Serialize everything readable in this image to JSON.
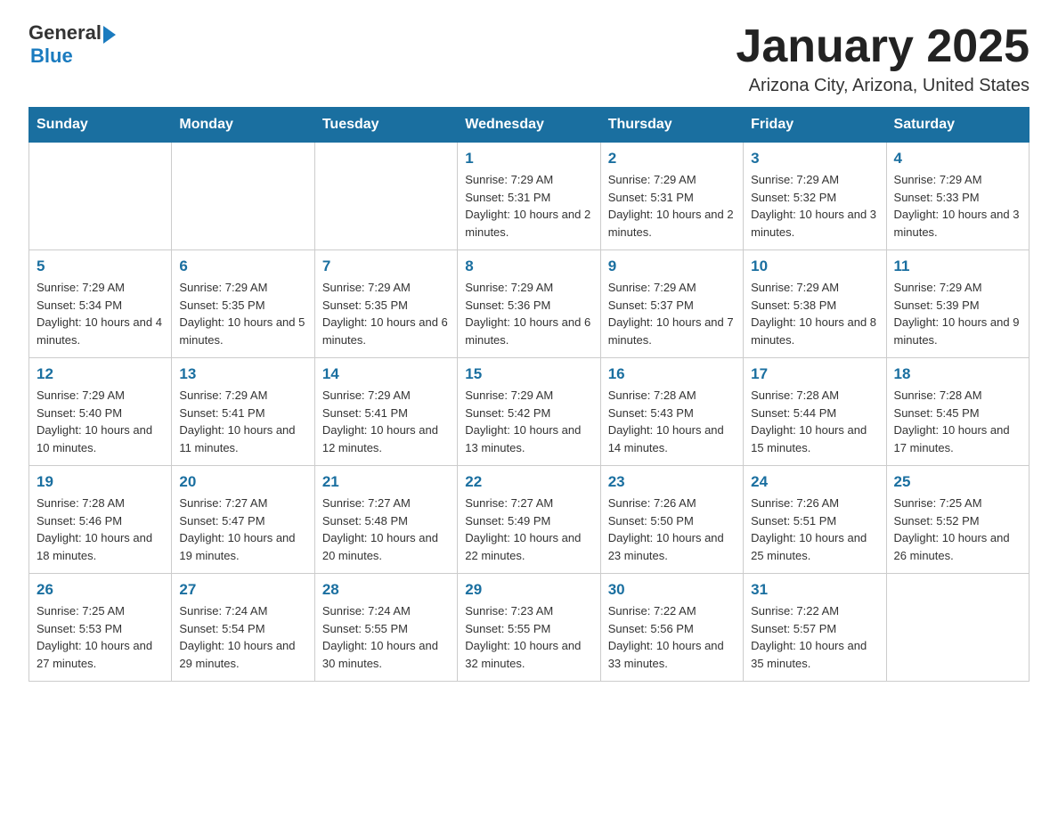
{
  "logo": {
    "general": "General",
    "blue": "Blue",
    "line2": "Blue"
  },
  "header": {
    "title": "January 2025",
    "subtitle": "Arizona City, Arizona, United States"
  },
  "days_of_week": [
    "Sunday",
    "Monday",
    "Tuesday",
    "Wednesday",
    "Thursday",
    "Friday",
    "Saturday"
  ],
  "weeks": [
    [
      {
        "day": "",
        "info": ""
      },
      {
        "day": "",
        "info": ""
      },
      {
        "day": "",
        "info": ""
      },
      {
        "day": "1",
        "info": "Sunrise: 7:29 AM\nSunset: 5:31 PM\nDaylight: 10 hours and 2 minutes."
      },
      {
        "day": "2",
        "info": "Sunrise: 7:29 AM\nSunset: 5:31 PM\nDaylight: 10 hours and 2 minutes."
      },
      {
        "day": "3",
        "info": "Sunrise: 7:29 AM\nSunset: 5:32 PM\nDaylight: 10 hours and 3 minutes."
      },
      {
        "day": "4",
        "info": "Sunrise: 7:29 AM\nSunset: 5:33 PM\nDaylight: 10 hours and 3 minutes."
      }
    ],
    [
      {
        "day": "5",
        "info": "Sunrise: 7:29 AM\nSunset: 5:34 PM\nDaylight: 10 hours and 4 minutes."
      },
      {
        "day": "6",
        "info": "Sunrise: 7:29 AM\nSunset: 5:35 PM\nDaylight: 10 hours and 5 minutes."
      },
      {
        "day": "7",
        "info": "Sunrise: 7:29 AM\nSunset: 5:35 PM\nDaylight: 10 hours and 6 minutes."
      },
      {
        "day": "8",
        "info": "Sunrise: 7:29 AM\nSunset: 5:36 PM\nDaylight: 10 hours and 6 minutes."
      },
      {
        "day": "9",
        "info": "Sunrise: 7:29 AM\nSunset: 5:37 PM\nDaylight: 10 hours and 7 minutes."
      },
      {
        "day": "10",
        "info": "Sunrise: 7:29 AM\nSunset: 5:38 PM\nDaylight: 10 hours and 8 minutes."
      },
      {
        "day": "11",
        "info": "Sunrise: 7:29 AM\nSunset: 5:39 PM\nDaylight: 10 hours and 9 minutes."
      }
    ],
    [
      {
        "day": "12",
        "info": "Sunrise: 7:29 AM\nSunset: 5:40 PM\nDaylight: 10 hours and 10 minutes."
      },
      {
        "day": "13",
        "info": "Sunrise: 7:29 AM\nSunset: 5:41 PM\nDaylight: 10 hours and 11 minutes."
      },
      {
        "day": "14",
        "info": "Sunrise: 7:29 AM\nSunset: 5:41 PM\nDaylight: 10 hours and 12 minutes."
      },
      {
        "day": "15",
        "info": "Sunrise: 7:29 AM\nSunset: 5:42 PM\nDaylight: 10 hours and 13 minutes."
      },
      {
        "day": "16",
        "info": "Sunrise: 7:28 AM\nSunset: 5:43 PM\nDaylight: 10 hours and 14 minutes."
      },
      {
        "day": "17",
        "info": "Sunrise: 7:28 AM\nSunset: 5:44 PM\nDaylight: 10 hours and 15 minutes."
      },
      {
        "day": "18",
        "info": "Sunrise: 7:28 AM\nSunset: 5:45 PM\nDaylight: 10 hours and 17 minutes."
      }
    ],
    [
      {
        "day": "19",
        "info": "Sunrise: 7:28 AM\nSunset: 5:46 PM\nDaylight: 10 hours and 18 minutes."
      },
      {
        "day": "20",
        "info": "Sunrise: 7:27 AM\nSunset: 5:47 PM\nDaylight: 10 hours and 19 minutes."
      },
      {
        "day": "21",
        "info": "Sunrise: 7:27 AM\nSunset: 5:48 PM\nDaylight: 10 hours and 20 minutes."
      },
      {
        "day": "22",
        "info": "Sunrise: 7:27 AM\nSunset: 5:49 PM\nDaylight: 10 hours and 22 minutes."
      },
      {
        "day": "23",
        "info": "Sunrise: 7:26 AM\nSunset: 5:50 PM\nDaylight: 10 hours and 23 minutes."
      },
      {
        "day": "24",
        "info": "Sunrise: 7:26 AM\nSunset: 5:51 PM\nDaylight: 10 hours and 25 minutes."
      },
      {
        "day": "25",
        "info": "Sunrise: 7:25 AM\nSunset: 5:52 PM\nDaylight: 10 hours and 26 minutes."
      }
    ],
    [
      {
        "day": "26",
        "info": "Sunrise: 7:25 AM\nSunset: 5:53 PM\nDaylight: 10 hours and 27 minutes."
      },
      {
        "day": "27",
        "info": "Sunrise: 7:24 AM\nSunset: 5:54 PM\nDaylight: 10 hours and 29 minutes."
      },
      {
        "day": "28",
        "info": "Sunrise: 7:24 AM\nSunset: 5:55 PM\nDaylight: 10 hours and 30 minutes."
      },
      {
        "day": "29",
        "info": "Sunrise: 7:23 AM\nSunset: 5:55 PM\nDaylight: 10 hours and 32 minutes."
      },
      {
        "day": "30",
        "info": "Sunrise: 7:22 AM\nSunset: 5:56 PM\nDaylight: 10 hours and 33 minutes."
      },
      {
        "day": "31",
        "info": "Sunrise: 7:22 AM\nSunset: 5:57 PM\nDaylight: 10 hours and 35 minutes."
      },
      {
        "day": "",
        "info": ""
      }
    ]
  ]
}
